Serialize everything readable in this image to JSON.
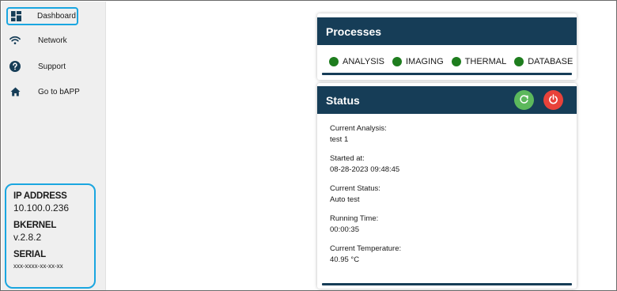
{
  "sidebar": {
    "items": [
      {
        "label": "Dashboard",
        "icon": "dashboard-icon",
        "active": true
      },
      {
        "label": "Network",
        "icon": "wifi-icon",
        "active": false
      },
      {
        "label": "Support",
        "icon": "help-icon",
        "active": false
      },
      {
        "label": "Go to bAPP",
        "icon": "home-icon",
        "active": false
      }
    ],
    "device_info": {
      "ip_label": "IP ADDRESS",
      "ip_value": "10.100.0.236",
      "kernel_label": "BKERNEL",
      "kernel_value": "v.2.8.2",
      "serial_label": "SERIAL",
      "serial_value": "xxx-xxxx-xx-xx-xx"
    }
  },
  "processes": {
    "title": "Processes",
    "items": [
      {
        "name": "ANALYSIS",
        "status_color": "#1e7d1e"
      },
      {
        "name": "IMAGING",
        "status_color": "#1e7d1e"
      },
      {
        "name": "THERMAL",
        "status_color": "#1e7d1e"
      },
      {
        "name": "DATABASE",
        "status_color": "#1e7d1e"
      }
    ]
  },
  "status": {
    "title": "Status",
    "refresh_icon": "refresh-icon",
    "power_icon": "power-icon",
    "fields": [
      {
        "label": "Current Analysis:",
        "value": "test 1"
      },
      {
        "label": "Started at:",
        "value": "08-28-2023 09:48:45"
      },
      {
        "label": "Current Status:",
        "value": "Auto test"
      },
      {
        "label": "Running Time:",
        "value": "00:00:35"
      },
      {
        "label": "Current Temperature:",
        "value": "40.95 °C"
      }
    ]
  },
  "colors": {
    "header_bg": "#163d57",
    "accent": "#1aa6e0",
    "ok": "#1e7d1e",
    "refresh": "#5cb85c",
    "power": "#e8423a"
  }
}
